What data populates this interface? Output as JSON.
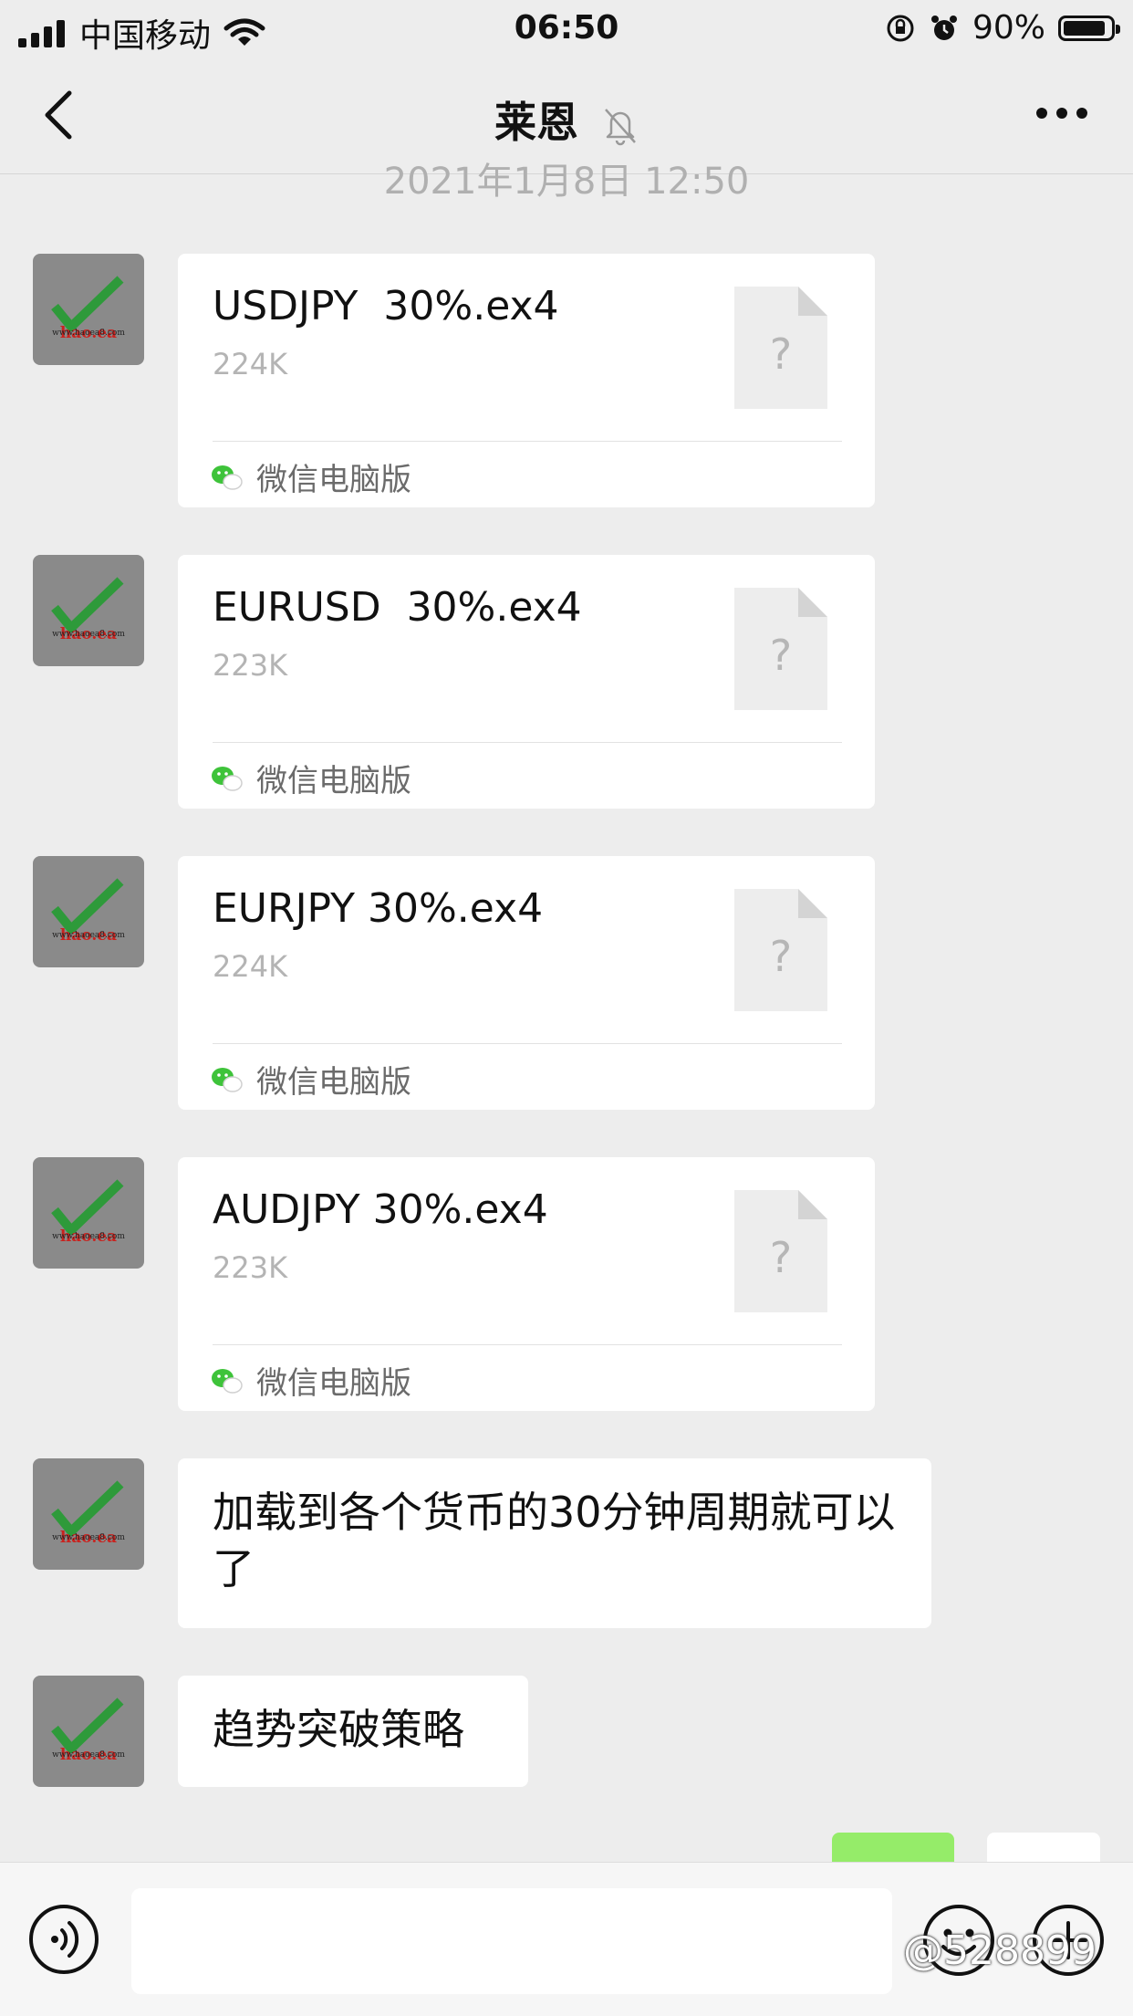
{
  "status_bar": {
    "carrier": "中国移动",
    "time": "06:50",
    "battery": "90%",
    "battery_level": 0.9
  },
  "header": {
    "title": "莱恩",
    "icons": [
      "back-chevron-icon",
      "muted-bell-icon",
      "more-dots-icon"
    ]
  },
  "timestamp": "2021年1月8日 12:50",
  "avatar_text": {
    "logo": "hao.ea",
    "site": "www.haoea8.com"
  },
  "messages": {
    "file1": {
      "name": "USDJPY  30%.ex4",
      "size": "224K",
      "source": "微信电脑版",
      "icon": "unknown-file-icon"
    },
    "file2": {
      "name": "EURUSD  30%.ex4",
      "size": "223K",
      "source": "微信电脑版",
      "icon": "unknown-file-icon"
    },
    "file3": {
      "name": "EURJPY 30%.ex4",
      "size": "224K",
      "source": "微信电脑版",
      "icon": "unknown-file-icon"
    },
    "file4": {
      "name": "AUDJPY 30%.ex4",
      "size": "223K",
      "source": "微信电脑版",
      "icon": "unknown-file-icon"
    },
    "text1": "加载到各个货币的30分钟周期就可以了",
    "text2": "趋势突破策略"
  },
  "file_icon_glyph": "?",
  "input_bar": {
    "value": "",
    "icons": [
      "voice-icon",
      "emoji-icon",
      "plus-icon"
    ]
  },
  "watermark": "@528899",
  "colors": {
    "background": "#ededed",
    "bubble": "#ffffff",
    "sent_bubble": "#95ec69",
    "secondary_text": "#b4b4b4"
  }
}
